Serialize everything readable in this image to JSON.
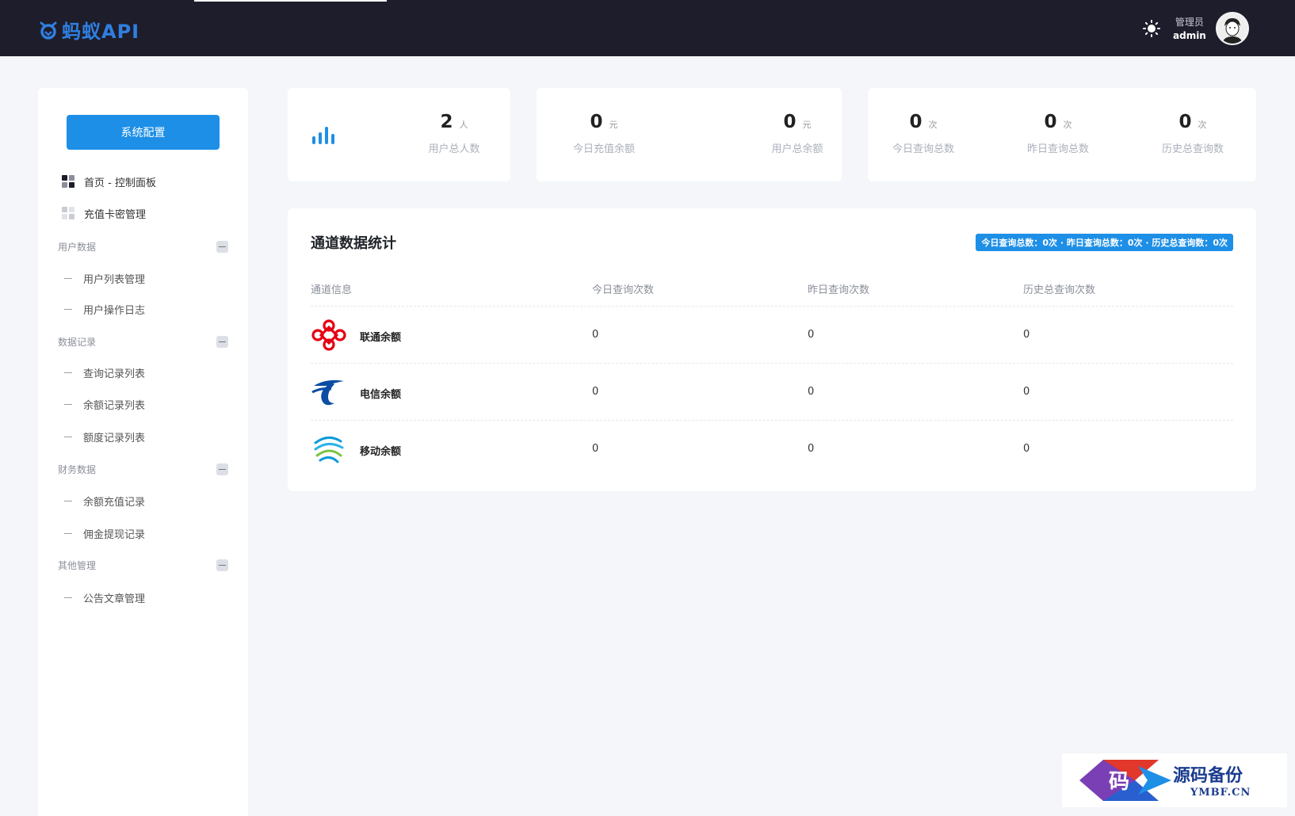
{
  "app": {
    "logo_text": "蚂蚁API",
    "user_role": "管理员",
    "user_name": "admin"
  },
  "sidebar": {
    "config_button": "系统配置",
    "top_items": [
      {
        "label": "首页 - 控制面板",
        "active": true
      },
      {
        "label": "充值卡密管理",
        "active": false
      }
    ],
    "groups": [
      {
        "title": "用户数据",
        "items": [
          "用户列表管理",
          "用户操作日志"
        ]
      },
      {
        "title": "数据记录",
        "items": [
          "查询记录列表",
          "余额记录列表",
          "额度记录列表"
        ]
      },
      {
        "title": "财务数据",
        "items": [
          "余额充值记录",
          "佣金提现记录"
        ]
      },
      {
        "title": "其他管理",
        "items": [
          "公告文章管理"
        ]
      }
    ]
  },
  "stats": {
    "users": {
      "value": "2",
      "unit": "人",
      "label": "用户总人数"
    },
    "today_recharge": {
      "value": "0",
      "unit": "元",
      "label": "今日充值余额"
    },
    "total_balance": {
      "value": "0",
      "unit": "元",
      "label": "用户总余额"
    },
    "today_queries": {
      "value": "0",
      "unit": "次",
      "label": "今日查询总数"
    },
    "yesterday_queries": {
      "value": "0",
      "unit": "次",
      "label": "昨日查询总数"
    },
    "history_queries": {
      "value": "0",
      "unit": "次",
      "label": "历史总查询数"
    }
  },
  "panel": {
    "title": "通道数据统计",
    "badge": "今日查询总数：0次 · 昨日查询总数：0次 · 历史总查询数：0次",
    "headers": [
      "通道信息",
      "今日查询次数",
      "昨日查询次数",
      "历史总查询次数"
    ],
    "rows": [
      {
        "name": "联通余额",
        "logo": "china-unicom-logo",
        "today": "0",
        "yesterday": "0",
        "history": "0"
      },
      {
        "name": "电信余额",
        "logo": "china-telecom-logo",
        "today": "0",
        "yesterday": "0",
        "history": "0"
      },
      {
        "name": "移动余额",
        "logo": "china-mobile-logo",
        "today": "0",
        "yesterday": "0",
        "history": "0"
      }
    ]
  },
  "watermark": {
    "glyph": "码",
    "title": "源码备份",
    "domain": "YMBF.CN"
  },
  "colors": {
    "topbar": "#1e1d2c",
    "accent": "#1e8fe6",
    "logo": "#2f7fdf",
    "background": "#f4f6f9"
  }
}
